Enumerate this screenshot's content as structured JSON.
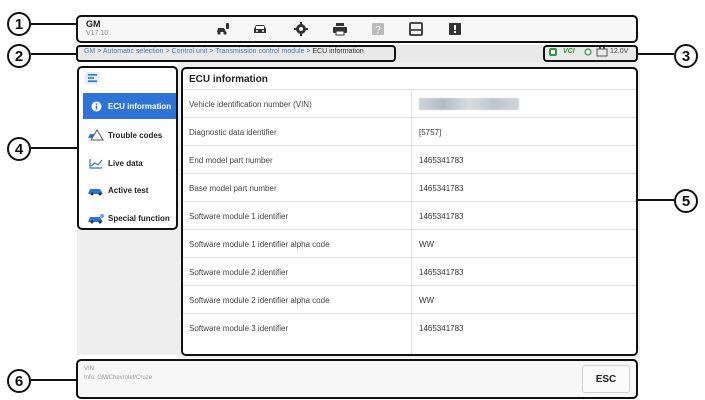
{
  "callouts": [
    "1",
    "2",
    "3",
    "4",
    "5",
    "6"
  ],
  "app": {
    "name": "GM",
    "version": "V17.10"
  },
  "toolbar": {
    "icons": [
      "car-service-icon",
      "car-icon",
      "gear-icon",
      "printer-icon",
      "help-icon",
      "save-icon",
      "feedback-icon"
    ]
  },
  "breadcrumb": {
    "path": "GM > Automatic selection > Control unit > Transmission control module > ",
    "current": "ECU information"
  },
  "status": {
    "vci": "VCI",
    "battery": "12.0V"
  },
  "sidebar": {
    "items": [
      {
        "label": "ECU information",
        "icon": "info-icon",
        "active": true
      },
      {
        "label": "Trouble codes",
        "icon": "car-warning-icon",
        "active": false
      },
      {
        "label": "Live data",
        "icon": "graph-icon",
        "active": false
      },
      {
        "label": "Active test",
        "icon": "car-test-icon",
        "active": false
      },
      {
        "label": "Special function",
        "icon": "car-function-icon",
        "active": false
      }
    ]
  },
  "main": {
    "title": "ECU information",
    "rows": [
      {
        "key": "Vehicle identification number (VIN)",
        "value": ""
      },
      {
        "key": "Diagnostic data identifier",
        "value": "[5757]"
      },
      {
        "key": "End model part number",
        "value": "1465341783"
      },
      {
        "key": "Base model part number",
        "value": "1465341783"
      },
      {
        "key": "Software module 1 identifier",
        "value": "1465341783"
      },
      {
        "key": "Software module 1 identifier alpha code",
        "value": "WW"
      },
      {
        "key": "Software module 2 identifier",
        "value": "1465341783"
      },
      {
        "key": "Software module 2 identifier alpha code",
        "value": "WW"
      },
      {
        "key": "Software module 3 identifier",
        "value": "1465341783"
      }
    ]
  },
  "footer": {
    "vin_label": "VIN:",
    "info": "Info: GM/Chevrolet/Cruze",
    "esc_label": "ESC"
  },
  "colors": {
    "accent": "#2e74d6",
    "link": "#4a78c2",
    "vci_green": "#2a9a3a"
  }
}
